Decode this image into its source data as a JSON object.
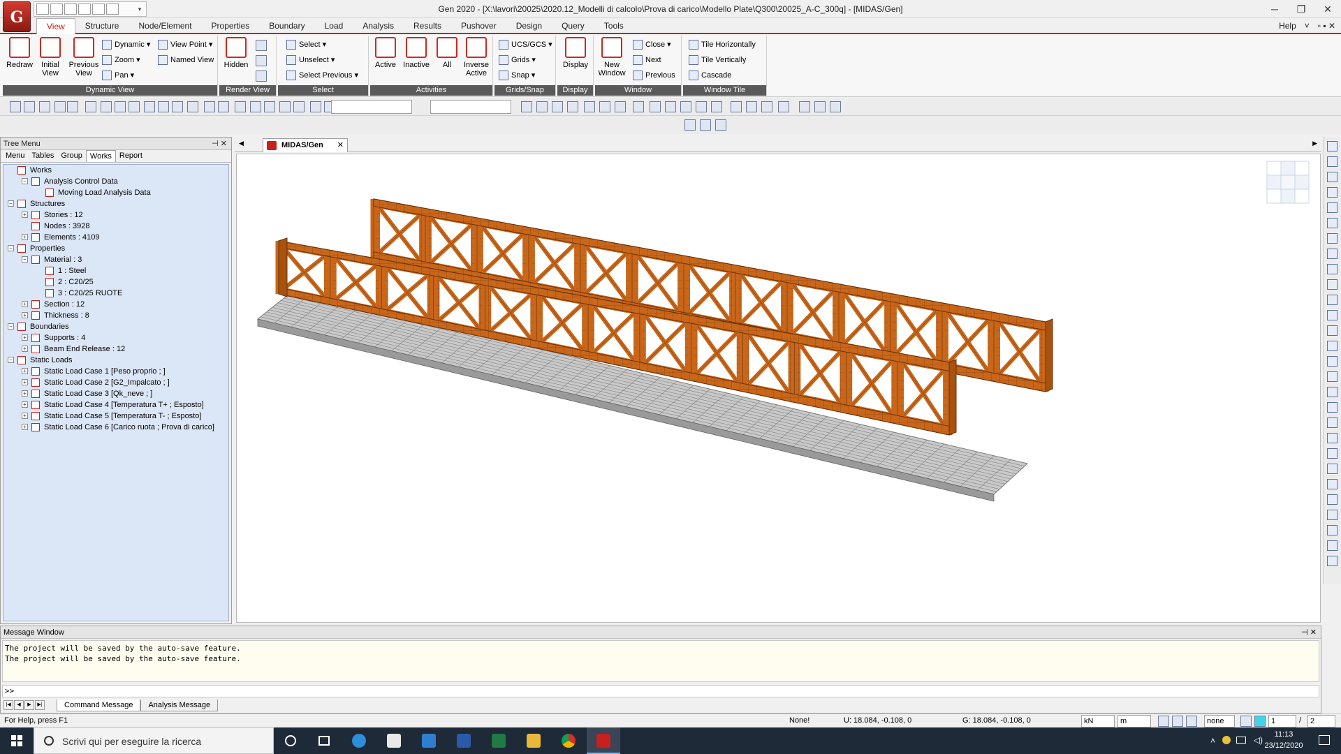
{
  "window": {
    "title": "Gen 2020 - [X:\\lavori\\20025\\2020.12_Modelli di calcolo\\Prova di carico\\Modello Plate\\Q300\\20025_A-C_300q] - [MIDAS/Gen]",
    "logo": "G",
    "min": "─",
    "restore": "❐",
    "close": "✕"
  },
  "ribbon_tabs": [
    "View",
    "Structure",
    "Node/Element",
    "Properties",
    "Boundary",
    "Load",
    "Analysis",
    "Results",
    "Pushover",
    "Design",
    "Query",
    "Tools"
  ],
  "help": {
    "label": "Help",
    "arrow": "˅",
    "extra": "▫ ▪ ✕"
  },
  "ribbon": {
    "dynamic_view": {
      "label": "Dynamic View",
      "redraw": "Redraw",
      "initial_view": "Initial View",
      "previous_view": "Previous View",
      "dynamic": "Dynamic",
      "zoom": "Zoom",
      "pan": "Pan",
      "view_point": "View Point",
      "named_view": "Named View"
    },
    "render_view": {
      "label": "Render View",
      "hidden": "Hidden"
    },
    "select": {
      "label": "Select",
      "select": "Select",
      "unselect": "Unselect",
      "select_previous": "Select Previous"
    },
    "activities": {
      "label": "Activities",
      "active": "Active",
      "inactive": "Inactive",
      "all": "All",
      "inverse_active": "Inverse Active"
    },
    "grids_snap": {
      "label": "Grids/Snap",
      "ucs": "UCS/GCS",
      "grids": "Grids",
      "snap": "Snap"
    },
    "display": {
      "label": "Display",
      "display": "Display"
    },
    "window_group": {
      "label": "Window",
      "new_window": "New Window",
      "close": "Close",
      "next": "Next",
      "previous": "Previous"
    },
    "window_tile": {
      "label": "Window Tile",
      "tile_h": "Tile Horizontally",
      "tile_v": "Tile Vertically",
      "cascade": "Cascade"
    }
  },
  "tree": {
    "title": "Tree Menu",
    "controls": "⊣ ✕",
    "tabs": [
      "Menu",
      "Tables",
      "Group",
      "Works",
      "Report"
    ],
    "active_tab": "Works",
    "items": [
      {
        "label": "Works",
        "level": 0,
        "exp": ""
      },
      {
        "label": "Analysis Control Data",
        "level": 1,
        "exp": "−"
      },
      {
        "label": "Moving Load Analysis Data",
        "level": 2,
        "exp": ""
      },
      {
        "label": "Structures",
        "level": 0,
        "exp": "−"
      },
      {
        "label": "Stories : 12",
        "level": 1,
        "exp": "+"
      },
      {
        "label": "Nodes : 3928",
        "level": 1,
        "exp": ""
      },
      {
        "label": "Elements : 4109",
        "level": 1,
        "exp": "+"
      },
      {
        "label": "Properties",
        "level": 0,
        "exp": "−"
      },
      {
        "label": "Material : 3",
        "level": 1,
        "exp": "−"
      },
      {
        "label": "1 : Steel",
        "level": 2,
        "exp": ""
      },
      {
        "label": "2 : C20/25",
        "level": 2,
        "exp": ""
      },
      {
        "label": "3 : C20/25 RUOTE",
        "level": 2,
        "exp": ""
      },
      {
        "label": "Section : 12",
        "level": 1,
        "exp": "+"
      },
      {
        "label": "Thickness : 8",
        "level": 1,
        "exp": "+"
      },
      {
        "label": "Boundaries",
        "level": 0,
        "exp": "−"
      },
      {
        "label": "Supports : 4",
        "level": 1,
        "exp": "+"
      },
      {
        "label": "Beam End Release : 12",
        "level": 1,
        "exp": "+"
      },
      {
        "label": "Static Loads",
        "level": 0,
        "exp": "−"
      },
      {
        "label": "Static Load Case 1 [Peso proprio ; ]",
        "level": 1,
        "exp": "+"
      },
      {
        "label": "Static Load Case 2 [G2_Impalcato ; ]",
        "level": 1,
        "exp": "+"
      },
      {
        "label": "Static Load Case 3 [Qk_neve ; ]",
        "level": 1,
        "exp": "+"
      },
      {
        "label": "Static Load Case 4 [Temperatura T+ ; Esposto]",
        "level": 1,
        "exp": "+"
      },
      {
        "label": "Static Load Case 5 [Temperatura T- ; Esposto]",
        "level": 1,
        "exp": "+"
      },
      {
        "label": "Static Load Case 6 [Carico ruota ; Prova di carico]",
        "level": 1,
        "exp": "+"
      }
    ]
  },
  "doc_tab": {
    "label": "MIDAS/Gen",
    "close": "✕"
  },
  "message_window": {
    "title": "Message Window",
    "controls": "⊣ ✕",
    "lines": [
      "The project will be saved by the auto-save feature.",
      "The project will be saved by the auto-save feature."
    ],
    "prompt": ">>",
    "tabs": [
      "Command Message",
      "Analysis Message"
    ]
  },
  "status": {
    "help": "For Help, press F1",
    "sel": "None!",
    "u": "U: 18.084, -0.108, 0",
    "g": "G: 18.084, -0.108, 0",
    "force_unit": "kN",
    "length_unit": "m",
    "none": "none",
    "page": "1",
    "sep": "/",
    "total": "2"
  },
  "taskbar": {
    "search_placeholder": "Scrivi qui per eseguire la ricerca",
    "time": "11:13",
    "date": "23/12/2020"
  },
  "colors": {
    "steel": "#c8661a",
    "deck": "#c9c9c9",
    "accent": "#c8201a"
  }
}
